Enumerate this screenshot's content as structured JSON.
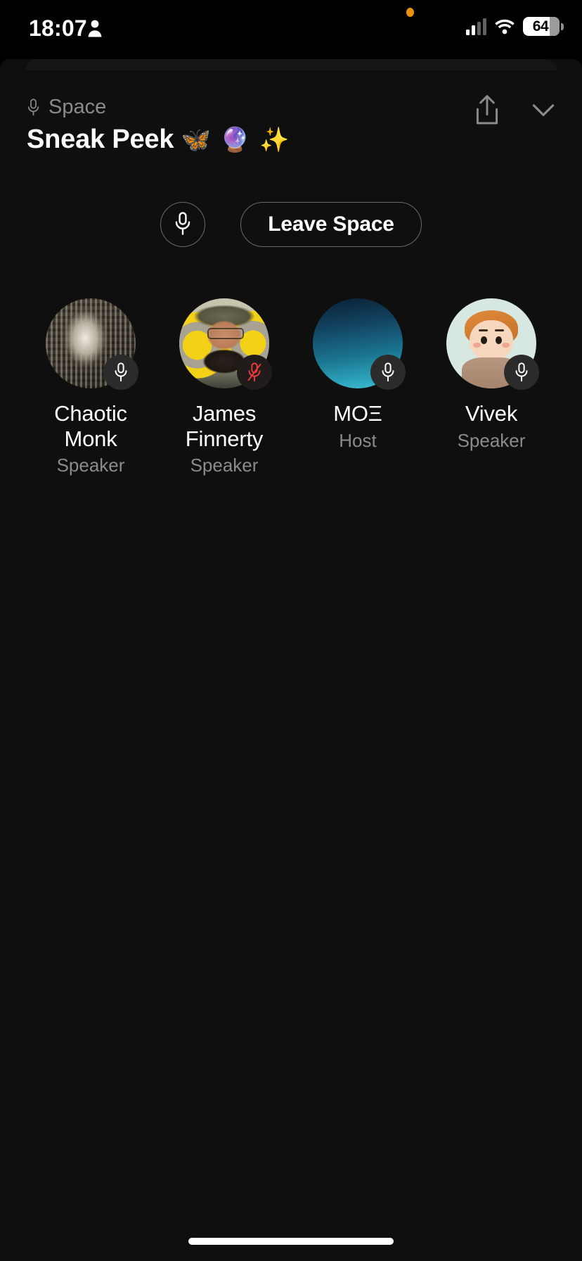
{
  "status_bar": {
    "time": "18:07",
    "person_icon": "person-icon",
    "privacy_dot_color": "#E8920C",
    "cell_icon": "cellular-bars-icon",
    "wifi_icon": "wifi-icon",
    "battery_percent": "64",
    "battery_icon": "battery-icon"
  },
  "header": {
    "kicker_icon": "microphone-icon",
    "kicker_label": "Space",
    "title": "Sneak Peek",
    "title_emoji": "🦋 🔮 ✨",
    "share_icon": "share-up-arrow-icon",
    "collapse_icon": "chevron-down-icon"
  },
  "controls": {
    "mic_toggle_icon": "microphone-icon",
    "leave_label": "Leave Space"
  },
  "participants": [
    {
      "name": "Chaotic Monk",
      "role": "Speaker",
      "avatar": "statue-photo-avatar",
      "mic_state": "unmuted",
      "mic_icon": "microphone-icon"
    },
    {
      "name": "James Finnerty",
      "role": "Speaker",
      "avatar": "man-with-glasses-photo-avatar",
      "mic_state": "muted",
      "mic_icon": "microphone-slash-icon",
      "muted_color": "#ED3A3A"
    },
    {
      "name": "MOΞ",
      "role": "Host",
      "avatar": "blue-gradient-avatar",
      "mic_state": "unmuted",
      "mic_icon": "microphone-icon"
    },
    {
      "name": "Vivek",
      "role": "Speaker",
      "avatar": "memoji-cartoon-avatar",
      "mic_state": "unmuted",
      "mic_icon": "microphone-icon"
    }
  ],
  "system": {
    "home_indicator": "home-indicator"
  },
  "colors": {
    "background": "#000000",
    "sheet": "#0f0f0f",
    "text_primary": "#ffffff",
    "text_secondary": "#8b8b8d",
    "border": "#6a6a6c",
    "muted_red": "#ED3A3A"
  }
}
